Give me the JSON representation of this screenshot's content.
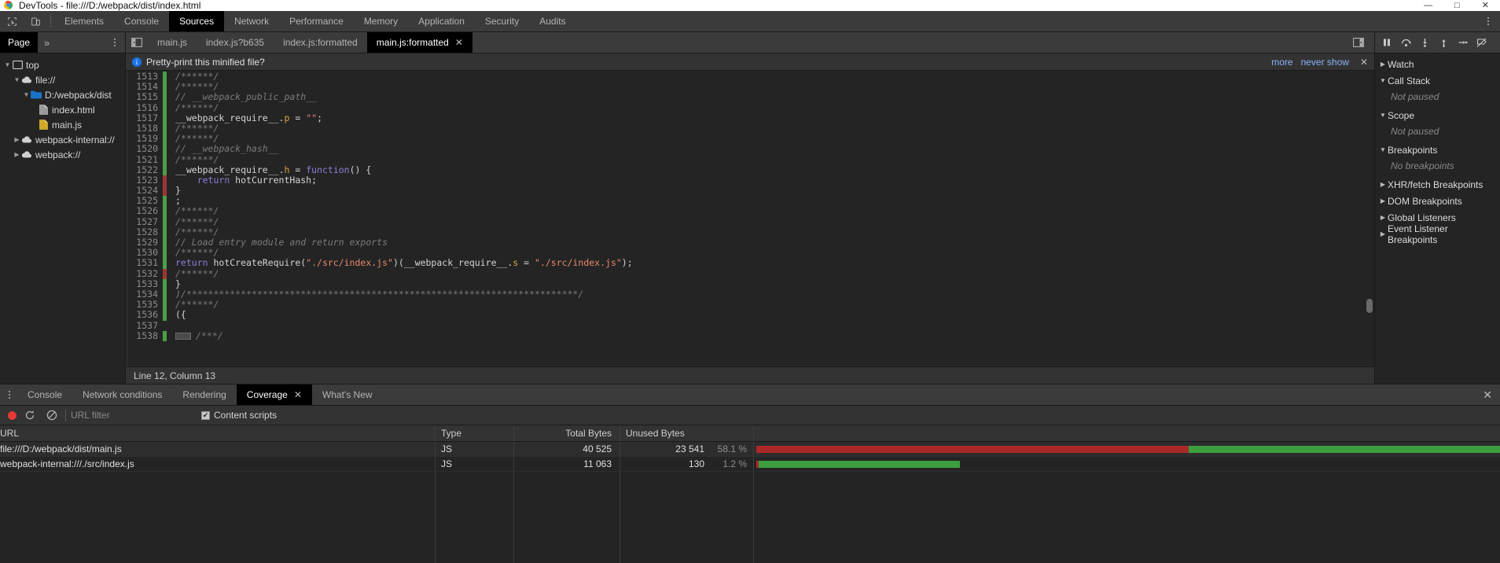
{
  "titlebar": {
    "title": "DevTools - file:///D:/webpack/dist/index.html",
    "minimize": "—",
    "maximize": "□",
    "close": "✕"
  },
  "main_tabs": {
    "inspect_icon": "inspect-cursor-icon",
    "device_icon": "device-toolbar-icon",
    "items": [
      {
        "label": "Elements",
        "active": false
      },
      {
        "label": "Console",
        "active": false
      },
      {
        "label": "Sources",
        "active": true
      },
      {
        "label": "Network",
        "active": false
      },
      {
        "label": "Performance",
        "active": false
      },
      {
        "label": "Memory",
        "active": false
      },
      {
        "label": "Application",
        "active": false
      },
      {
        "label": "Security",
        "active": false
      },
      {
        "label": "Audits",
        "active": false
      }
    ]
  },
  "navigator": {
    "tabs": [
      {
        "label": "Page",
        "active": true
      }
    ],
    "more_label": "»",
    "tree": [
      {
        "label": "top",
        "indent": 0,
        "twisty": "▼",
        "icon": "frame-icon"
      },
      {
        "label": "file://",
        "indent": 1,
        "twisty": "▼",
        "icon": "cloud-icon"
      },
      {
        "label": "D:/webpack/dist",
        "indent": 2,
        "twisty": "▼",
        "icon": "folder-icon"
      },
      {
        "label": "index.html",
        "indent": 3,
        "twisty": "",
        "icon": "html-file-icon"
      },
      {
        "label": "main.js",
        "indent": 3,
        "twisty": "",
        "icon": "js-file-icon"
      },
      {
        "label": "webpack-internal://",
        "indent": 1,
        "twisty": "▶",
        "icon": "cloud-icon"
      },
      {
        "label": "webpack://",
        "indent": 1,
        "twisty": "▶",
        "icon": "cloud-icon"
      }
    ]
  },
  "file_tabs": {
    "panel_icon": "show-navigator-icon",
    "right_icon": "show-debugger-icon",
    "items": [
      {
        "label": "main.js",
        "active": false,
        "closable": false
      },
      {
        "label": "index.js?b635",
        "active": false,
        "closable": false
      },
      {
        "label": "index.js:formatted",
        "active": false,
        "closable": false
      },
      {
        "label": "main.js:formatted",
        "active": true,
        "closable": true
      }
    ],
    "close_glyph": "✕"
  },
  "infobar": {
    "badge": "i",
    "message": "Pretty-print this minified file?",
    "more_label": "more",
    "never_show_label": "never show",
    "close_glyph": "✕"
  },
  "editor": {
    "status": "Line 12, Column 13",
    "lines": [
      {
        "no": "1513",
        "cov": "g",
        "fold": false,
        "tokens": [
          {
            "t": "/******/",
            "c": "c-com"
          }
        ]
      },
      {
        "no": "1514",
        "cov": "g",
        "fold": false,
        "tokens": [
          {
            "t": "/******/",
            "c": "c-com"
          }
        ]
      },
      {
        "no": "1515",
        "cov": "g",
        "fold": false,
        "tokens": [
          {
            "t": "// __webpack_public_path__",
            "c": "c-com"
          }
        ]
      },
      {
        "no": "1516",
        "cov": "g",
        "fold": false,
        "tokens": [
          {
            "t": "/******/",
            "c": "c-com"
          }
        ]
      },
      {
        "no": "1517",
        "cov": "g",
        "fold": false,
        "tokens": [
          {
            "t": "__webpack_require__",
            "c": "c-fn"
          },
          {
            "t": ".",
            "c": "c-fn"
          },
          {
            "t": "p",
            "c": "c-prop"
          },
          {
            "t": " = ",
            "c": "c-fn"
          },
          {
            "t": "\"\"",
            "c": "c-str"
          },
          {
            "t": ";",
            "c": "c-fn"
          }
        ]
      },
      {
        "no": "1518",
        "cov": "g",
        "fold": false,
        "tokens": [
          {
            "t": "/******/",
            "c": "c-com"
          }
        ]
      },
      {
        "no": "1519",
        "cov": "g",
        "fold": false,
        "tokens": [
          {
            "t": "/******/",
            "c": "c-com"
          }
        ]
      },
      {
        "no": "1520",
        "cov": "g",
        "fold": false,
        "tokens": [
          {
            "t": "// __webpack_hash__",
            "c": "c-com"
          }
        ]
      },
      {
        "no": "1521",
        "cov": "g",
        "fold": false,
        "tokens": [
          {
            "t": "/******/",
            "c": "c-com"
          }
        ]
      },
      {
        "no": "1522",
        "cov": "g",
        "fold": false,
        "tokens": [
          {
            "t": "__webpack_require__",
            "c": "c-fn"
          },
          {
            "t": ".",
            "c": "c-fn"
          },
          {
            "t": "h",
            "c": "c-prop"
          },
          {
            "t": " = ",
            "c": "c-fn"
          },
          {
            "t": "function",
            "c": "c-kw"
          },
          {
            "t": "() {",
            "c": "c-fn"
          }
        ]
      },
      {
        "no": "1523",
        "cov": "r",
        "fold": false,
        "tokens": [
          {
            "t": "    ",
            "c": "c-fn"
          },
          {
            "t": "return",
            "c": "c-kw"
          },
          {
            "t": " hotCurrentHash;",
            "c": "c-fn"
          }
        ]
      },
      {
        "no": "1524",
        "cov": "r",
        "fold": false,
        "tokens": [
          {
            "t": "}",
            "c": "c-fn"
          }
        ]
      },
      {
        "no": "1525",
        "cov": "g",
        "fold": false,
        "tokens": [
          {
            "t": ";",
            "c": "c-fn"
          }
        ]
      },
      {
        "no": "1526",
        "cov": "g",
        "fold": false,
        "tokens": [
          {
            "t": "/******/",
            "c": "c-com"
          }
        ]
      },
      {
        "no": "1527",
        "cov": "g",
        "fold": false,
        "tokens": [
          {
            "t": "/******/",
            "c": "c-com"
          }
        ]
      },
      {
        "no": "1528",
        "cov": "g",
        "fold": false,
        "tokens": [
          {
            "t": "/******/",
            "c": "c-com"
          }
        ]
      },
      {
        "no": "1529",
        "cov": "g",
        "fold": false,
        "tokens": [
          {
            "t": "// Load entry module and return exports",
            "c": "c-com"
          }
        ]
      },
      {
        "no": "1530",
        "cov": "g",
        "fold": false,
        "tokens": [
          {
            "t": "/******/",
            "c": "c-com"
          }
        ]
      },
      {
        "no": "1531",
        "cov": "g",
        "fold": false,
        "tokens": [
          {
            "t": "return",
            "c": "c-kw"
          },
          {
            "t": " hotCreateRequire(",
            "c": "c-fn"
          },
          {
            "t": "\"./src/index.js\"",
            "c": "c-str"
          },
          {
            "t": ")(__webpack_require__",
            "c": "c-fn"
          },
          {
            "t": ".",
            "c": "c-fn"
          },
          {
            "t": "s",
            "c": "c-prop"
          },
          {
            "t": " = ",
            "c": "c-fn"
          },
          {
            "t": "\"./src/index.js\"",
            "c": "c-str"
          },
          {
            "t": ");",
            "c": "c-fn"
          }
        ]
      },
      {
        "no": "1532",
        "cov": "r",
        "fold": false,
        "tokens": [
          {
            "t": "/******/",
            "c": "c-com"
          }
        ]
      },
      {
        "no": "1533",
        "cov": "g",
        "fold": false,
        "tokens": [
          {
            "t": "}",
            "c": "c-fn"
          }
        ]
      },
      {
        "no": "1534",
        "cov": "g",
        "fold": false,
        "tokens": [
          {
            "t": ")/************************************************************************/",
            "c": "c-com"
          }
        ]
      },
      {
        "no": "1535",
        "cov": "g",
        "fold": false,
        "tokens": [
          {
            "t": "/******/",
            "c": "c-com"
          }
        ]
      },
      {
        "no": "1536",
        "cov": "g",
        "fold": false,
        "tokens": [
          {
            "t": "({",
            "c": "c-fn"
          }
        ]
      },
      {
        "no": "1537",
        "cov": "n",
        "fold": false,
        "tokens": [
          {
            "t": "",
            "c": "c-fn"
          }
        ]
      },
      {
        "no": "1538",
        "cov": "g",
        "fold": true,
        "tokens": [
          {
            "t": "/***/",
            "c": "c-com"
          }
        ]
      }
    ]
  },
  "debugger": {
    "buttons": [
      {
        "icon": "pause-resume-icon"
      },
      {
        "icon": "step-over-icon"
      },
      {
        "icon": "step-into-icon"
      },
      {
        "icon": "step-out-icon"
      },
      {
        "icon": "step-icon"
      },
      {
        "icon": "deactivate-breakpoints-icon"
      }
    ],
    "sections": [
      {
        "title": "Watch",
        "arrow": "▶",
        "body": null
      },
      {
        "title": "Call Stack",
        "arrow": "▼",
        "body": "Not paused"
      },
      {
        "title": "Scope",
        "arrow": "▼",
        "body": "Not paused"
      },
      {
        "title": "Breakpoints",
        "arrow": "▼",
        "body": "No breakpoints"
      },
      {
        "title": "XHR/fetch Breakpoints",
        "arrow": "▶",
        "body": null
      },
      {
        "title": "DOM Breakpoints",
        "arrow": "▶",
        "body": null
      },
      {
        "title": "Global Listeners",
        "arrow": "▶",
        "body": null
      },
      {
        "title": "Event Listener Breakpoints",
        "arrow": "▶",
        "body": null
      }
    ]
  },
  "drawer": {
    "tabs": [
      {
        "label": "Console",
        "active": false,
        "closable": false
      },
      {
        "label": "Network conditions",
        "active": false,
        "closable": false
      },
      {
        "label": "Rendering",
        "active": false,
        "closable": false
      },
      {
        "label": "Coverage",
        "active": true,
        "closable": true
      },
      {
        "label": "What's New",
        "active": false,
        "closable": false
      }
    ],
    "close_glyph": "✕",
    "drawer_close": "✕"
  },
  "coverage": {
    "record_icon": "record-icon",
    "reload_icon": "reload-icon",
    "clear_icon": "clear-icon",
    "url_filter_placeholder": "URL filter",
    "url_filter_value": "",
    "content_scripts_label": "Content scripts",
    "content_scripts_checked": true,
    "checkmark": "✔",
    "columns": [
      "URL",
      "Type",
      "Total Bytes",
      "Unused Bytes",
      ""
    ],
    "rows": [
      {
        "url": "file:///D:/webpack/dist/main.js",
        "type": "JS",
        "total_bytes": "40 525",
        "unused_bytes": "23 541",
        "pct": "58.1 %",
        "unused_ratio": 58.1,
        "bar_width_pct": 100,
        "color_unused": "#ab2828",
        "color_used": "#3c9e3c"
      },
      {
        "url": "webpack-internal:///./src/index.js",
        "type": "JS",
        "total_bytes": "11 063",
        "unused_bytes": "130",
        "pct": "1.2 %",
        "unused_ratio": 1.2,
        "bar_width_pct": 27.4,
        "color_unused": "#ab2828",
        "color_used": "#3c9e3c"
      }
    ]
  }
}
